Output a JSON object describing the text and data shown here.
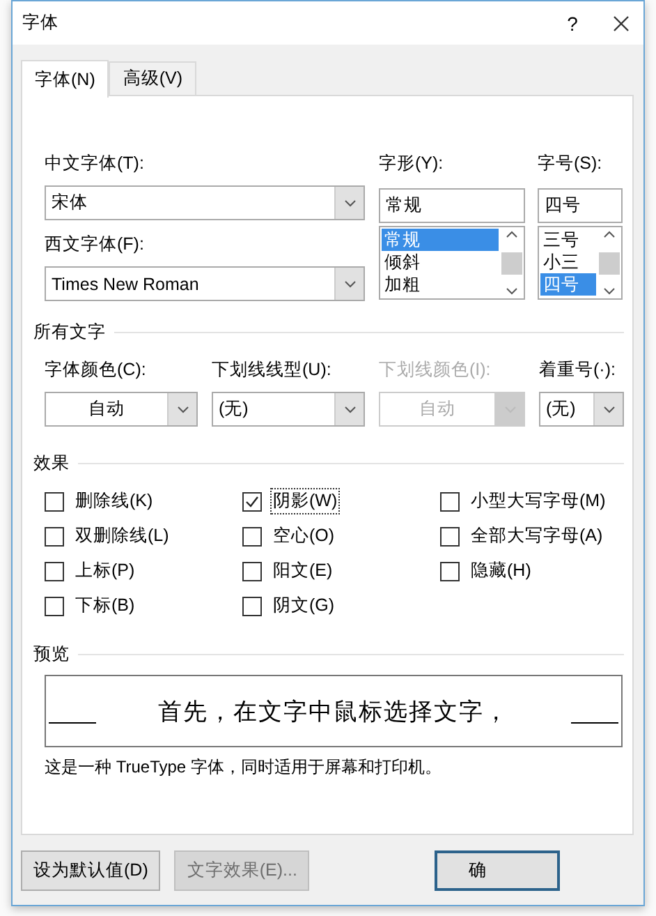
{
  "window": {
    "title": "字体",
    "help": "?"
  },
  "tabs": [
    {
      "label": "字体(N)",
      "selected": true
    },
    {
      "label": "高级(V)",
      "selected": false
    }
  ],
  "chinese_font": {
    "label": "中文字体(T):",
    "value": "宋体"
  },
  "western_font": {
    "label": "西文字体(F):",
    "value": "Times New Roman"
  },
  "font_style": {
    "label": "字形(Y):",
    "value": "常规",
    "options": [
      {
        "text": "常规",
        "selected": true
      },
      {
        "text": "倾斜",
        "selected": false
      },
      {
        "text": "加粗",
        "selected": false
      }
    ]
  },
  "font_size": {
    "label": "字号(S):",
    "value": "四号",
    "options": [
      {
        "text": "三号",
        "selected": false
      },
      {
        "text": "小三",
        "selected": false
      },
      {
        "text": "四号",
        "selected": true
      }
    ]
  },
  "all_text": {
    "heading": "所有文字",
    "fields": [
      {
        "kind": "color",
        "label": "字体颜色(C):",
        "value": "自动",
        "disabled": false
      },
      {
        "kind": "select",
        "label": "下划线线型(U):",
        "value": "(无)",
        "disabled": false
      },
      {
        "kind": "color",
        "label": "下划线颜色(I):",
        "value": "自动",
        "disabled": true
      },
      {
        "kind": "select",
        "label": "着重号(·):",
        "value": "(无)",
        "disabled": false
      }
    ]
  },
  "effects": {
    "heading": "效果",
    "columns": [
      {
        "items": [
          {
            "label": "删除线(K)",
            "checked": false,
            "focused": false
          },
          {
            "label": "双删除线(L)",
            "checked": false,
            "focused": false
          },
          {
            "label": "上标(P)",
            "checked": false,
            "focused": false
          },
          {
            "label": "下标(B)",
            "checked": false,
            "focused": false
          }
        ]
      },
      {
        "items": [
          {
            "label": "阴影(W)",
            "checked": true,
            "focused": true
          },
          {
            "label": "空心(O)",
            "checked": false,
            "focused": false
          },
          {
            "label": "阳文(E)",
            "checked": false,
            "focused": false
          },
          {
            "label": "阴文(G)",
            "checked": false,
            "focused": false
          }
        ]
      },
      {
        "items": [
          {
            "label": "小型大写字母(M)",
            "checked": false,
            "focused": false
          },
          {
            "label": "全部大写字母(A)",
            "checked": false,
            "focused": false
          },
          {
            "label": "隐藏(H)",
            "checked": false,
            "focused": false
          }
        ]
      }
    ]
  },
  "preview": {
    "heading": "预览",
    "sample": "首先，在文字中鼠标选择文字，",
    "note": "这是一种 TrueType 字体，同时适用于屏幕和打印机。"
  },
  "buttons": [
    {
      "label": "设为默认值(D)",
      "disabled": false,
      "default": false
    },
    {
      "label": "文字效果(E)...",
      "disabled": true,
      "default": false
    },
    {
      "label": "确",
      "disabled": false,
      "default": true
    }
  ]
}
